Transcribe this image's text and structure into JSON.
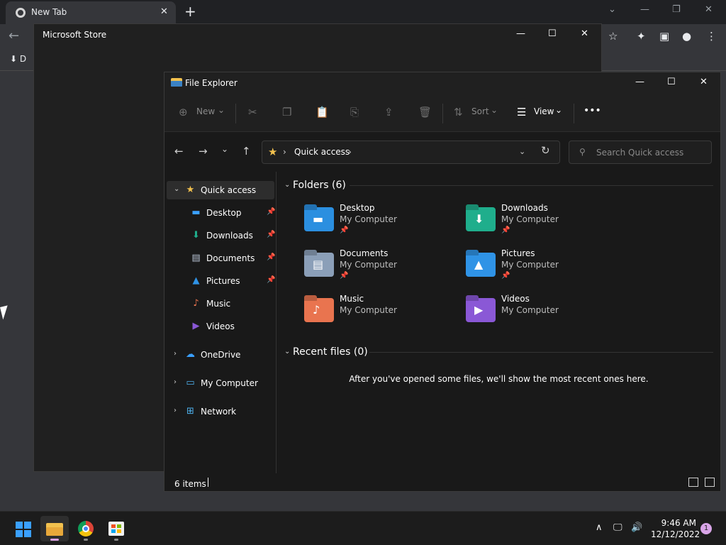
{
  "chrome": {
    "tab_title": "New Tab",
    "tab_close": "✕",
    "new_tab": "+",
    "window_controls": [
      "⌄",
      "—",
      "❐",
      "✕"
    ],
    "back": "←",
    "toolbar_icons": [
      "☆",
      "✦",
      "▣",
      "●",
      "⋮"
    ],
    "bookmark_item": "⬇ D"
  },
  "store": {
    "title": "Microsoft Store",
    "controls": [
      "—",
      "☐",
      "✕"
    ]
  },
  "explorer": {
    "title": "File Explorer",
    "controls": [
      "—",
      "☐",
      "✕"
    ],
    "commands": {
      "new_label": "New",
      "new_icon": "⊕",
      "chevron": "⌄",
      "cut_icon": "✂",
      "copy_icon": "❐",
      "paste_icon": "📋",
      "rename_icon": "⎘",
      "share_icon": "⇪",
      "delete_icon": "🗑",
      "sort_icon": "⇅",
      "sort_label": "Sort",
      "view_icon": "☰",
      "view_label": "View",
      "more_icon": "•••"
    },
    "nav": {
      "back": "←",
      "forward": "→",
      "recent": "⌄",
      "up": "↑",
      "breadcrumb_sep": "›",
      "location": "Quick access",
      "dropdown": "⌄",
      "refresh": "↻"
    },
    "search": {
      "icon": "⚲",
      "placeholder": "Search Quick access",
      "value": ""
    },
    "sidebar": {
      "quick_access": {
        "label": "Quick access",
        "icon": "★",
        "caret": "⌄"
      },
      "pin_icon": "📌",
      "pinned": [
        {
          "label": "Desktop",
          "icon": "▬"
        },
        {
          "label": "Downloads",
          "icon": "⬇"
        },
        {
          "label": "Documents",
          "icon": "▤"
        },
        {
          "label": "Pictures",
          "icon": "▲"
        }
      ],
      "unpinned": [
        {
          "label": "Music",
          "icon": "♪"
        },
        {
          "label": "Videos",
          "icon": "▶"
        }
      ],
      "roots": [
        {
          "label": "OneDrive",
          "icon": "☁",
          "caret": "›"
        },
        {
          "label": "My Computer",
          "icon": "▭",
          "caret": "›"
        },
        {
          "label": "Network",
          "icon": "⊞",
          "caret": "›"
        }
      ]
    },
    "content": {
      "folders_caret": "⌄",
      "folders_title": "Folders (6)",
      "folders": [
        {
          "name": "Desktop",
          "location": "My Computer",
          "pinned": true,
          "color": "#2b8fe0",
          "glyph": "▬"
        },
        {
          "name": "Downloads",
          "location": "My Computer",
          "pinned": true,
          "color": "#1fae8c",
          "glyph": "⬇"
        },
        {
          "name": "Documents",
          "location": "My Computer",
          "pinned": true,
          "color": "#8b9fb8",
          "glyph": "▤"
        },
        {
          "name": "Pictures",
          "location": "My Computer",
          "pinned": true,
          "color": "#2f93e6",
          "glyph": "▲"
        },
        {
          "name": "Music",
          "location": "My Computer",
          "pinned": false,
          "color": "#e9744f",
          "glyph": "♪"
        },
        {
          "name": "Videos",
          "location": "My Computer",
          "pinned": false,
          "color": "#8a58d6",
          "glyph": "▶"
        }
      ],
      "recent_caret": "⌄",
      "recent_title": "Recent files (0)",
      "empty_message": "After you've opened some files, we'll show the most recent ones here."
    },
    "status": {
      "items": "6 items"
    }
  },
  "taskbar": {
    "tray_icons": [
      "∧",
      "🖵",
      "🔊"
    ],
    "time": "9:46 AM",
    "date": "12/12/2022",
    "notification_count": "1"
  }
}
